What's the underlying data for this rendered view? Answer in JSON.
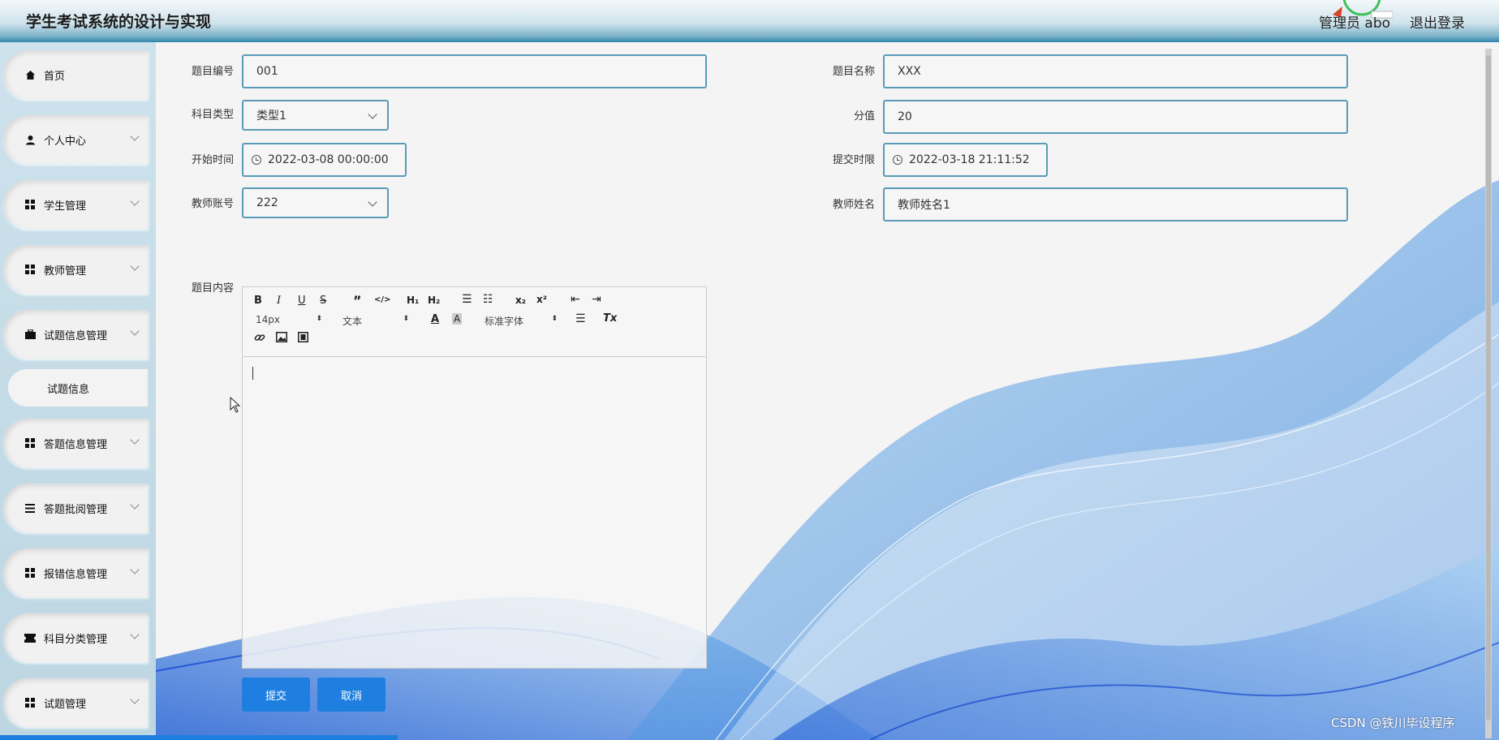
{
  "header": {
    "title": "学生考试系统的设计与实现",
    "user": "管理员 abo",
    "logout": "退出登录"
  },
  "sidebar": {
    "items": [
      {
        "label": "首页",
        "icon": "home-icon"
      },
      {
        "label": "个人中心",
        "icon": "user-icon"
      },
      {
        "label": "学生管理",
        "icon": "grid-icon"
      },
      {
        "label": "教师管理",
        "icon": "grid-icon"
      },
      {
        "label": "试题信息管理",
        "icon": "briefcase-icon"
      },
      {
        "label": "答题信息管理",
        "icon": "grid-icon"
      },
      {
        "label": "答题批阅管理",
        "icon": "list-icon"
      },
      {
        "label": "报错信息管理",
        "icon": "grid-icon"
      },
      {
        "label": "科目分类管理",
        "icon": "ticket-icon"
      },
      {
        "label": "试题管理",
        "icon": "grid-icon"
      }
    ],
    "sub_item": "试题信息"
  },
  "form": {
    "code_label": "题目编号",
    "code_value": "001",
    "name_label": "题目名称",
    "name_value": "XXX",
    "type_label": "科目类型",
    "type_value": "类型1",
    "score_label": "分值",
    "score_value": "20",
    "start_label": "开始时间",
    "start_value": "2022-03-08 00:00:00",
    "deadline_label": "提交时限",
    "deadline_value": "2022-03-18 21:11:52",
    "teacher_account_label": "教师账号",
    "teacher_account_value": "222",
    "teacher_name_label": "教师姓名",
    "teacher_name_value": "教师姓名1",
    "content_label": "题目内容"
  },
  "editor": {
    "font_size": "14px",
    "text_type": "文本",
    "font_family": "标准字体"
  },
  "buttons": {
    "submit": "提交",
    "cancel": "取消"
  },
  "watermark": "CSDN @铁川毕设程序",
  "colors": {
    "accent": "#1f7fe0",
    "input_border": "#5a9bb8",
    "wave": "#1a6fd6"
  }
}
